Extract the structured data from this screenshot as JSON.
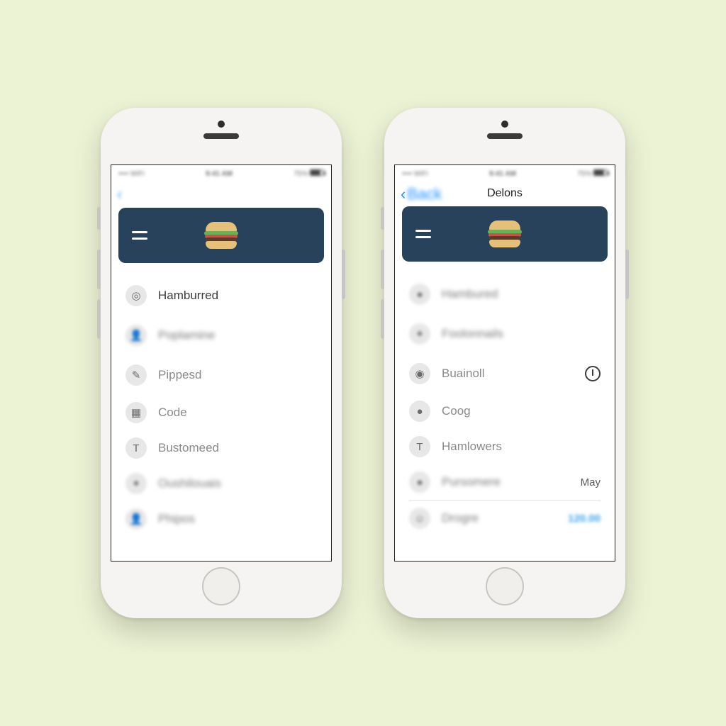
{
  "colors": {
    "header_bg": "#27425a",
    "bg": "#ecf2d4",
    "ios_blue": "#1e90ff"
  },
  "phone1": {
    "status": {
      "left": "•••• WiFi",
      "mid": "9:41 AM",
      "right": "75%"
    },
    "nav": {
      "back_label": "",
      "title": ""
    },
    "header_logo_name": "burger-logo",
    "list": [
      {
        "icon": "leaf-icon",
        "label": "Hamburred",
        "blurred": false
      },
      {
        "icon": "person-icon",
        "label": "Poplamine",
        "blurred": true
      },
      {
        "icon": "stroke-icon",
        "label": "Pippesd",
        "blurred": false
      },
      {
        "icon": "grid-icon",
        "label": "Code",
        "blurred": false
      },
      {
        "icon": "text-icon",
        "label": "Bustomeed",
        "blurred": false
      },
      {
        "icon": "gear-icon",
        "label": "Oushilouais",
        "blurred": true
      },
      {
        "icon": "person-icon",
        "label": "Phipos",
        "blurred": true
      }
    ]
  },
  "phone2": {
    "status": {
      "left": "•••• WiFi",
      "mid": "9:41 AM",
      "right": "75%"
    },
    "nav": {
      "back_label": "Back",
      "title": "Delons"
    },
    "header_logo_name": "burger-logo",
    "list": [
      {
        "icon": "dot-icon",
        "label": "Hambured",
        "blurred": true,
        "trail": ""
      },
      {
        "icon": "person-icon",
        "label": "Foolonnails",
        "blurred": true,
        "trail": ""
      },
      {
        "icon": "drop-icon",
        "label": "Buainoll",
        "blurred": false,
        "trail_kind": "power-icon"
      },
      {
        "icon": "dot-icon",
        "label": "Coog",
        "blurred": false,
        "trail": ""
      },
      {
        "icon": "text-icon",
        "label": "Hamlowers",
        "blurred": false,
        "trail": ""
      },
      {
        "icon": "dot-icon",
        "label": "Pursomere",
        "blurred": true,
        "trail": "May"
      },
      {
        "icon": "avatar-icon",
        "label": "Drogre",
        "blurred": true,
        "trail": "120.00",
        "trail_blue": true
      }
    ]
  }
}
